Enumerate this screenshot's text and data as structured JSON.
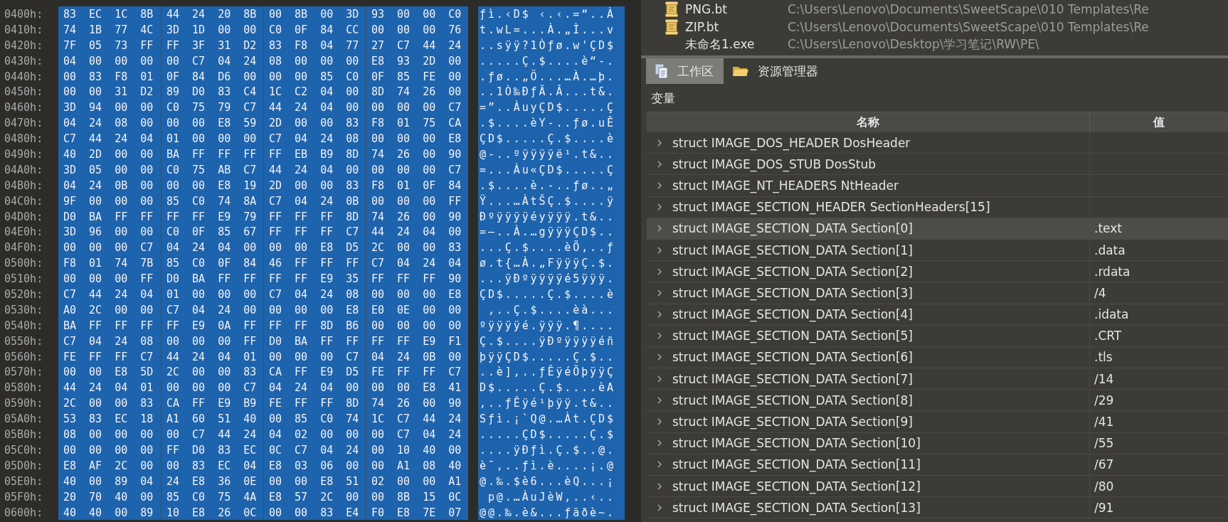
{
  "hex_view": {
    "rows": [
      {
        "offset": "0400h:",
        "selected": true,
        "groups": [
          "83 EC 1C 8B",
          "44 24 20 8B",
          "00 8B 00 3D",
          "93 00 00 C0"
        ],
        "ascii": "ƒì.‹D$ ‹.‹.=“..À"
      },
      {
        "offset": "0410h:",
        "selected": true,
        "groups": [
          "74 1B 77 4C",
          "3D 1D 00 00",
          "C0 0F 84 CC",
          "00 00 00 76"
        ],
        "ascii": "t.wL=...À.„Ì...v"
      },
      {
        "offset": "0420h:",
        "selected": true,
        "groups": [
          "7F 05 73 FF",
          "FF 3F 31 D2",
          "83 F8 04 77",
          "27 C7 44 24"
        ],
        "ascii": "..sÿÿ?1Òƒø.w'ÇD$"
      },
      {
        "offset": "0430h:",
        "selected": true,
        "groups": [
          "04 00 00 00",
          "00 C7 04 24",
          "08 00 00 00",
          "E8 93 2D 00"
        ],
        "ascii": ".....Ç.$....è“-."
      },
      {
        "offset": "0440h:",
        "selected": true,
        "groups": [
          "00 83 F8 01",
          "0F 84 D6 00",
          "00 00 85 C0",
          "0F 85 FE 00"
        ],
        "ascii": ".ƒø..„Ö...…À.…þ."
      },
      {
        "offset": "0450h:",
        "selected": true,
        "groups": [
          "00 00 31 D2",
          "89 D0 83 C4",
          "1C C2 04 00",
          "8D 74 26 00"
        ],
        "ascii": "..1Ò‰ÐƒÄ.Â...t&."
      },
      {
        "offset": "0460h:",
        "selected": true,
        "groups": [
          "3D 94 00 00",
          "C0 75 79 C7",
          "44 24 04 00",
          "00 00 00 C7"
        ],
        "ascii": "=”..ÀuyÇD$.....Ç"
      },
      {
        "offset": "0470h:",
        "selected": true,
        "groups": [
          "04 24 08 00",
          "00 00 E8 59",
          "2D 00 00 83",
          "F8 01 75 CA"
        ],
        "ascii": ".$....èY-..ƒø.uÊ"
      },
      {
        "offset": "0480h:",
        "selected": true,
        "groups": [
          "C7 44 24 04",
          "01 00 00 00",
          "C7 04 24 08",
          "00 00 00 E8"
        ],
        "ascii": "ÇD$.....Ç.$....è"
      },
      {
        "offset": "0490h:",
        "selected": true,
        "groups": [
          "40 2D 00 00",
          "BA FF FF FF",
          "FF EB B9 8D",
          "74 26 00 90"
        ],
        "ascii": "@-..ºÿÿÿÿë¹.t&.."
      },
      {
        "offset": "04A0h:",
        "selected": true,
        "groups": [
          "3D 05 00 00",
          "C0 75 AB C7",
          "44 24 04 00",
          "00 00 00 C7"
        ],
        "ascii": "=...Àu«ÇD$.....Ç"
      },
      {
        "offset": "04B0h:",
        "selected": true,
        "groups": [
          "04 24 0B 00",
          "00 00 E8 19",
          "2D 00 00 83",
          "F8 01 0F 84"
        ],
        "ascii": ".$....è.-..ƒø..„"
      },
      {
        "offset": "04C0h:",
        "selected": true,
        "groups": [
          "9F 00 00 00",
          "85 C0 74 8A",
          "C7 04 24 0B",
          "00 00 00 FF"
        ],
        "ascii": "Ÿ...…ÀtŠÇ.$....ÿ"
      },
      {
        "offset": "04D0h:",
        "selected": true,
        "groups": [
          "D0 BA FF FF",
          "FF FF E9 79",
          "FF FF FF 8D",
          "74 26 00 90"
        ],
        "ascii": "Ðºÿÿÿÿéyÿÿÿ.t&.."
      },
      {
        "offset": "04E0h:",
        "selected": true,
        "groups": [
          "3D 96 00 00",
          "C0 0F 85 67",
          "FF FF FF C7",
          "44 24 04 00"
        ],
        "ascii": "=–..À.…gÿÿÿÇD$.."
      },
      {
        "offset": "04F0h:",
        "selected": true,
        "groups": [
          "00 00 00 C7",
          "04 24 04 00",
          "00 00 E8 D5",
          "2C 00 00 83"
        ],
        "ascii": "...Ç.$....èÕ,..ƒ"
      },
      {
        "offset": "0500h:",
        "selected": true,
        "groups": [
          "F8 01 74 7B",
          "85 C0 0F 84",
          "46 FF FF FF",
          "C7 04 24 04"
        ],
        "ascii": "ø.t{…À.„FÿÿÿÇ.$."
      },
      {
        "offset": "0510h:",
        "selected": true,
        "groups": [
          "00 00 00 FF",
          "D0 BA FF FF",
          "FF FF E9 35",
          "FF FF FF 90"
        ],
        "ascii": "...ÿÐºÿÿÿÿé5ÿÿÿ."
      },
      {
        "offset": "0520h:",
        "selected": true,
        "groups": [
          "C7 44 24 04",
          "01 00 00 00",
          "C7 04 24 08",
          "00 00 00 E8"
        ],
        "ascii": "ÇD$.....Ç.$....è"
      },
      {
        "offset": "0530h:",
        "selected": true,
        "groups": [
          "A0 2C 00 00",
          "C7 04 24 00",
          "00 00 00 E8",
          "E0 0E 00 00"
        ],
        "ascii": " ,..Ç.$....èà..."
      },
      {
        "offset": "0540h:",
        "selected": true,
        "groups": [
          "BA FF FF FF",
          "FF E9 0A FF",
          "FF FF 8D B6",
          "00 00 00 00"
        ],
        "ascii": "ºÿÿÿÿé.ÿÿÿ.¶...."
      },
      {
        "offset": "0550h:",
        "selected": true,
        "groups": [
          "C7 04 24 08",
          "00 00 00 FF",
          "D0 BA FF FF",
          "FF FF E9 F1"
        ],
        "ascii": "Ç.$....ÿÐºÿÿÿÿéñ"
      },
      {
        "offset": "0560h:",
        "selected": true,
        "groups": [
          "FE FF FF C7",
          "44 24 04 01",
          "00 00 00 C7",
          "04 24 0B 00"
        ],
        "ascii": "þÿÿÇD$.....Ç.$.."
      },
      {
        "offset": "0570h:",
        "selected": true,
        "groups": [
          "00 00 E8 5D",
          "2C 00 00 83",
          "CA FF E9 D5",
          "FE FF FF C7"
        ],
        "ascii": "..è],..ƒÊÿéÕþÿÿÇ"
      },
      {
        "offset": "0580h:",
        "selected": true,
        "groups": [
          "44 24 04 01",
          "00 00 00 C7",
          "04 24 04 00",
          "00 00 E8 41"
        ],
        "ascii": "D$.....Ç.$....èA"
      },
      {
        "offset": "0590h:",
        "selected": true,
        "groups": [
          "2C 00 00 83",
          "CA FF E9 B9",
          "FE FF FF 8D",
          "74 26 00 90"
        ],
        "ascii": ",..ƒÊÿé¹þÿÿ.t&.."
      },
      {
        "offset": "05A0h:",
        "selected": true,
        "groups": [
          "53 83 EC 18",
          "A1 60 51 40",
          "00 85 C0 74",
          "1C C7 44 24"
        ],
        "ascii": "Sƒì.¡`Q@.…Àt.ÇD$"
      },
      {
        "offset": "05B0h:",
        "selected": true,
        "groups": [
          "08 00 00 00",
          "00 C7 44 24",
          "04 02 00 00",
          "00 C7 04 24"
        ],
        "ascii": ".....ÇD$.....Ç.$"
      },
      {
        "offset": "05C0h:",
        "selected": true,
        "groups": [
          "00 00 00 00",
          "FF D0 83 EC",
          "0C C7 04 24",
          "00 10 40 00"
        ],
        "ascii": "....ÿÐƒì.Ç.$..@."
      },
      {
        "offset": "05D0h:",
        "selected": true,
        "groups": [
          "E8 AF 2C 00",
          "00 83 EC 04",
          "E8 03 06 00",
          "00 A1 08 40"
        ],
        "ascii": "è¯,..ƒì.è....¡.@"
      },
      {
        "offset": "05E0h:",
        "selected": true,
        "groups": [
          "40 00 89 04",
          "24 E8 36 0E",
          "00 00 E8 51",
          "02 00 00 A1"
        ],
        "ascii": "@.‰.$è6...èQ...¡"
      },
      {
        "offset": "05F0h:",
        "selected": true,
        "groups": [
          "20 70 40 00",
          "85 C0 75 4A",
          "E8 57 2C 00",
          "00 8B 15 0C"
        ],
        "ascii": " p@.…ÀuJèW,..‹.."
      },
      {
        "offset": "0600h:",
        "selected": true,
        "groups": [
          "40 40 00 89",
          "10 E8 26 0C",
          "00 00 83 E4",
          "F0 E8 7E 07"
        ],
        "ascii": "@@.‰.è&...ƒäðè~."
      }
    ]
  },
  "recent_files": [
    {
      "kind": "template",
      "name": "PNG.bt",
      "path": "C:\\Users\\Lenovo\\Documents\\SweetScape\\010 Templates\\Re"
    },
    {
      "kind": "template",
      "name": "ZIP.bt",
      "path": "C:\\Users\\Lenovo\\Documents\\SweetScape\\010 Templates\\Re"
    },
    {
      "kind": "file",
      "name": "未命名1.exe",
      "path": "C:\\Users\\Lenovo\\Desktop\\学习笔记\\RW\\PE\\"
    }
  ],
  "tabs": [
    {
      "label": "工作区",
      "kind": "workspace",
      "selected": true
    },
    {
      "label": "资源管理器",
      "kind": "folder",
      "selected": false
    }
  ],
  "variables": {
    "title": "变量",
    "columns": [
      "名称",
      "值"
    ],
    "rows": [
      {
        "name": "struct IMAGE_DOS_HEADER DosHeader",
        "value": "",
        "expanded": false,
        "selected": false
      },
      {
        "name": "struct IMAGE_DOS_STUB DosStub",
        "value": "",
        "expanded": false,
        "selected": false
      },
      {
        "name": "struct IMAGE_NT_HEADERS NtHeader",
        "value": "",
        "expanded": false,
        "selected": false
      },
      {
        "name": "struct IMAGE_SECTION_HEADER SectionHeaders[15]",
        "value": "",
        "expanded": false,
        "selected": false
      },
      {
        "name": "struct IMAGE_SECTION_DATA Section[0]",
        "value": ".text",
        "expanded": false,
        "selected": true
      },
      {
        "name": "struct IMAGE_SECTION_DATA Section[1]",
        "value": ".data",
        "expanded": false,
        "selected": false
      },
      {
        "name": "struct IMAGE_SECTION_DATA Section[2]",
        "value": ".rdata",
        "expanded": false,
        "selected": false
      },
      {
        "name": "struct IMAGE_SECTION_DATA Section[3]",
        "value": "/4",
        "expanded": false,
        "selected": false
      },
      {
        "name": "struct IMAGE_SECTION_DATA Section[4]",
        "value": ".idata",
        "expanded": false,
        "selected": false
      },
      {
        "name": "struct IMAGE_SECTION_DATA Section[5]",
        "value": ".CRT",
        "expanded": false,
        "selected": false
      },
      {
        "name": "struct IMAGE_SECTION_DATA Section[6]",
        "value": ".tls",
        "expanded": false,
        "selected": false
      },
      {
        "name": "struct IMAGE_SECTION_DATA Section[7]",
        "value": "/14",
        "expanded": false,
        "selected": false
      },
      {
        "name": "struct IMAGE_SECTION_DATA Section[8]",
        "value": "/29",
        "expanded": false,
        "selected": false
      },
      {
        "name": "struct IMAGE_SECTION_DATA Section[9]",
        "value": "/41",
        "expanded": false,
        "selected": false
      },
      {
        "name": "struct IMAGE_SECTION_DATA Section[10]",
        "value": "/55",
        "expanded": false,
        "selected": false
      },
      {
        "name": "struct IMAGE_SECTION_DATA Section[11]",
        "value": "/67",
        "expanded": false,
        "selected": false
      },
      {
        "name": "struct IMAGE_SECTION_DATA Section[12]",
        "value": "/80",
        "expanded": false,
        "selected": false
      },
      {
        "name": "struct IMAGE_SECTION_DATA Section[13]",
        "value": "/91",
        "expanded": false,
        "selected": false
      }
    ]
  }
}
